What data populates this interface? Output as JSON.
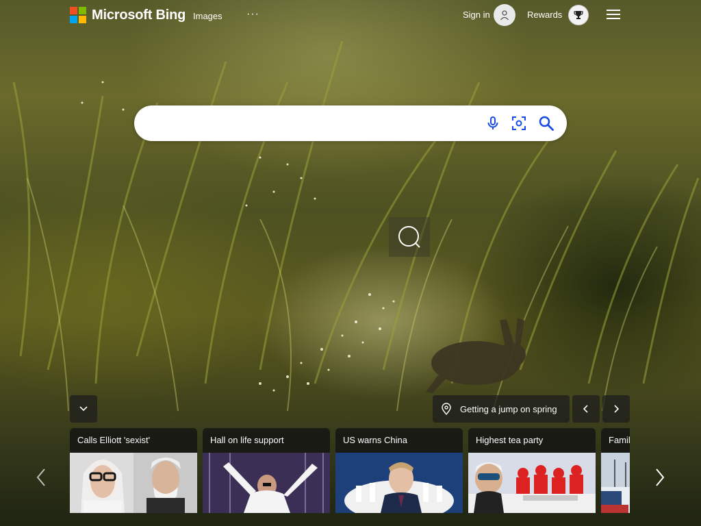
{
  "header": {
    "logo_text": "Microsoft Bing",
    "nav": {
      "images_label": "Images",
      "more_label": "···"
    },
    "signin_label": "Sign in",
    "rewards_label": "Rewards"
  },
  "search": {
    "placeholder": "",
    "value": ""
  },
  "image_info": {
    "title": "Getting a jump on spring"
  },
  "news": [
    {
      "title": "Calls Elliott 'sexist'"
    },
    {
      "title": "Hall on life support"
    },
    {
      "title": "US warns China"
    },
    {
      "title": "Highest tea party"
    },
    {
      "title": "Family"
    }
  ],
  "colors": {
    "ms_red": "#f25022",
    "ms_green": "#7fba00",
    "ms_blue": "#00a4ef",
    "ms_yellow": "#ffb900",
    "search_icon": "#174ae4"
  },
  "icons": {
    "mic": "microphone-icon",
    "visual_search": "visual-search-icon",
    "search": "magnifier-icon",
    "menu": "hamburger-menu-icon",
    "rewards": "trophy-icon",
    "location": "location-pin-icon"
  }
}
